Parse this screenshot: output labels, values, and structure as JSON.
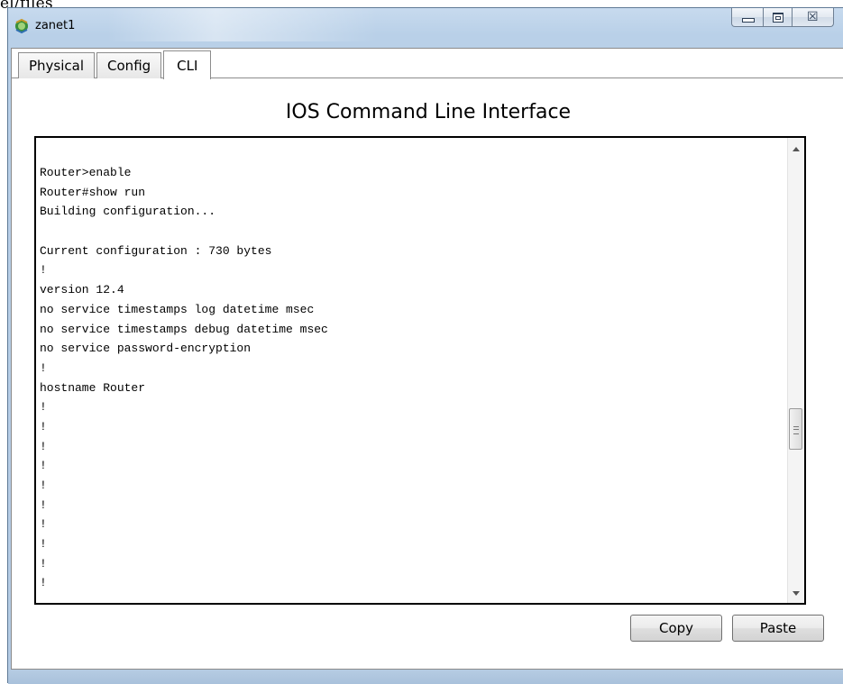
{
  "stray_text": "el/files",
  "window": {
    "title": "zanet1",
    "app_icon": "packet-tracer-router-icon",
    "caption_buttons": [
      "minimize-icon",
      "maximize-icon",
      "close-icon"
    ],
    "close_glyph": "☒"
  },
  "tabs": [
    {
      "label": "Physical",
      "active": false
    },
    {
      "label": "Config",
      "active": false
    },
    {
      "label": "CLI",
      "active": true
    }
  ],
  "panel_title": "IOS Command Line Interface",
  "console": {
    "lines": [
      "Router>enable",
      "Router#show run",
      "Building configuration...",
      "",
      "Current configuration : 730 bytes",
      "!",
      "version 12.4",
      "no service timestamps log datetime msec",
      "no service timestamps debug datetime msec",
      "no service password-encryption",
      "!",
      "hostname Router",
      "!",
      "!",
      "!",
      "!",
      "!",
      "!",
      "!",
      "!",
      "!",
      "!"
    ],
    "scroll_position": 0.65
  },
  "buttons": {
    "copy": "Copy",
    "paste": "Paste"
  }
}
